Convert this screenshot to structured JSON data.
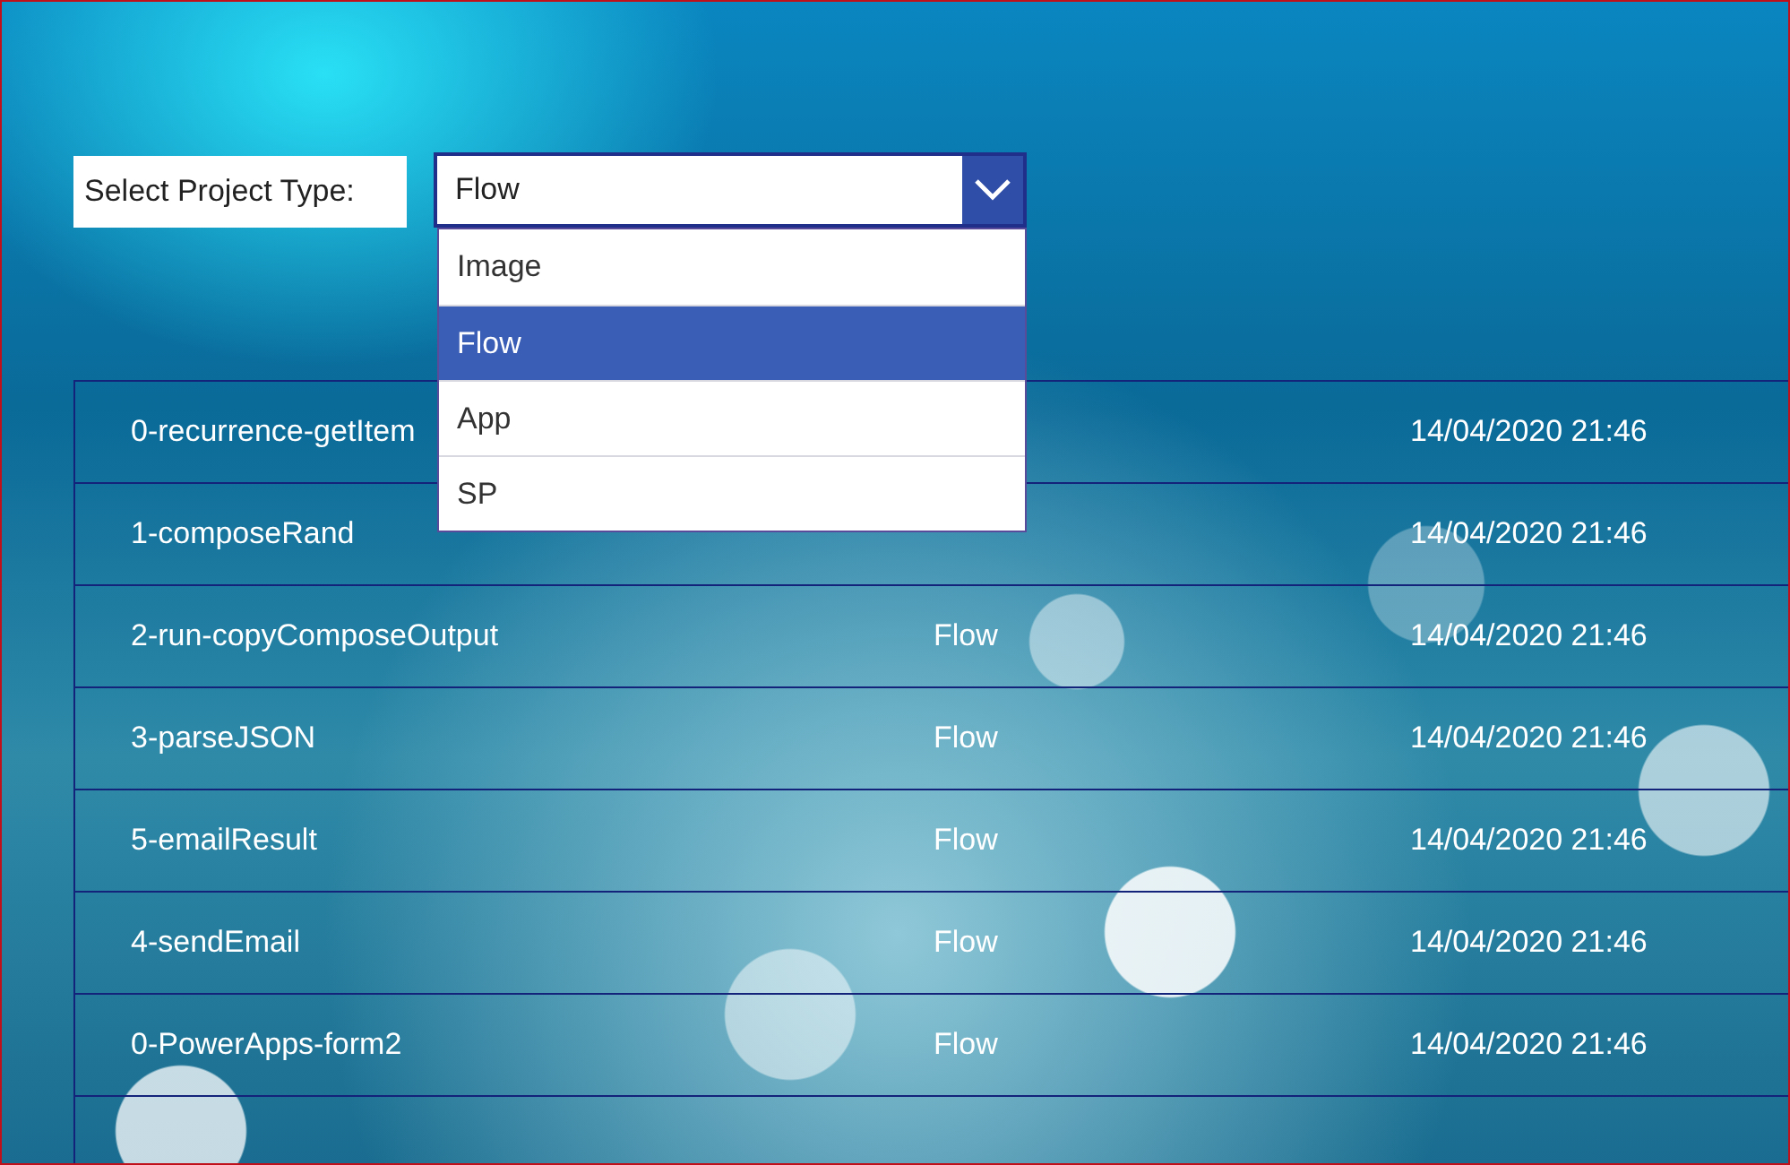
{
  "filter": {
    "label": "Select Project Type:",
    "value": "Flow",
    "expanded": true,
    "options": [
      {
        "label": "Image",
        "selected": false
      },
      {
        "label": "Flow",
        "selected": true
      },
      {
        "label": "App",
        "selected": false
      },
      {
        "label": "SP",
        "selected": false
      }
    ]
  },
  "rows": [
    {
      "name": "0-recurrence-getItem",
      "date": "14/04/2020 21:46"
    },
    {
      "name": "1-composeRand",
      "date": "14/04/2020 21:46"
    },
    {
      "name": "2-run-copyComposeOutput",
      "type": "Flow",
      "date": "14/04/2020 21:46"
    },
    {
      "name": "3-parseJSON",
      "type": "Flow",
      "date": "14/04/2020 21:46"
    },
    {
      "name": "5-emailResult",
      "type": "Flow",
      "date": "14/04/2020 21:46"
    },
    {
      "name": "4-sendEmail",
      "type": "Flow",
      "date": "14/04/2020 21:46"
    },
    {
      "name": "0-PowerApps-form2",
      "type": "Flow",
      "date": "14/04/2020 21:46"
    }
  ]
}
